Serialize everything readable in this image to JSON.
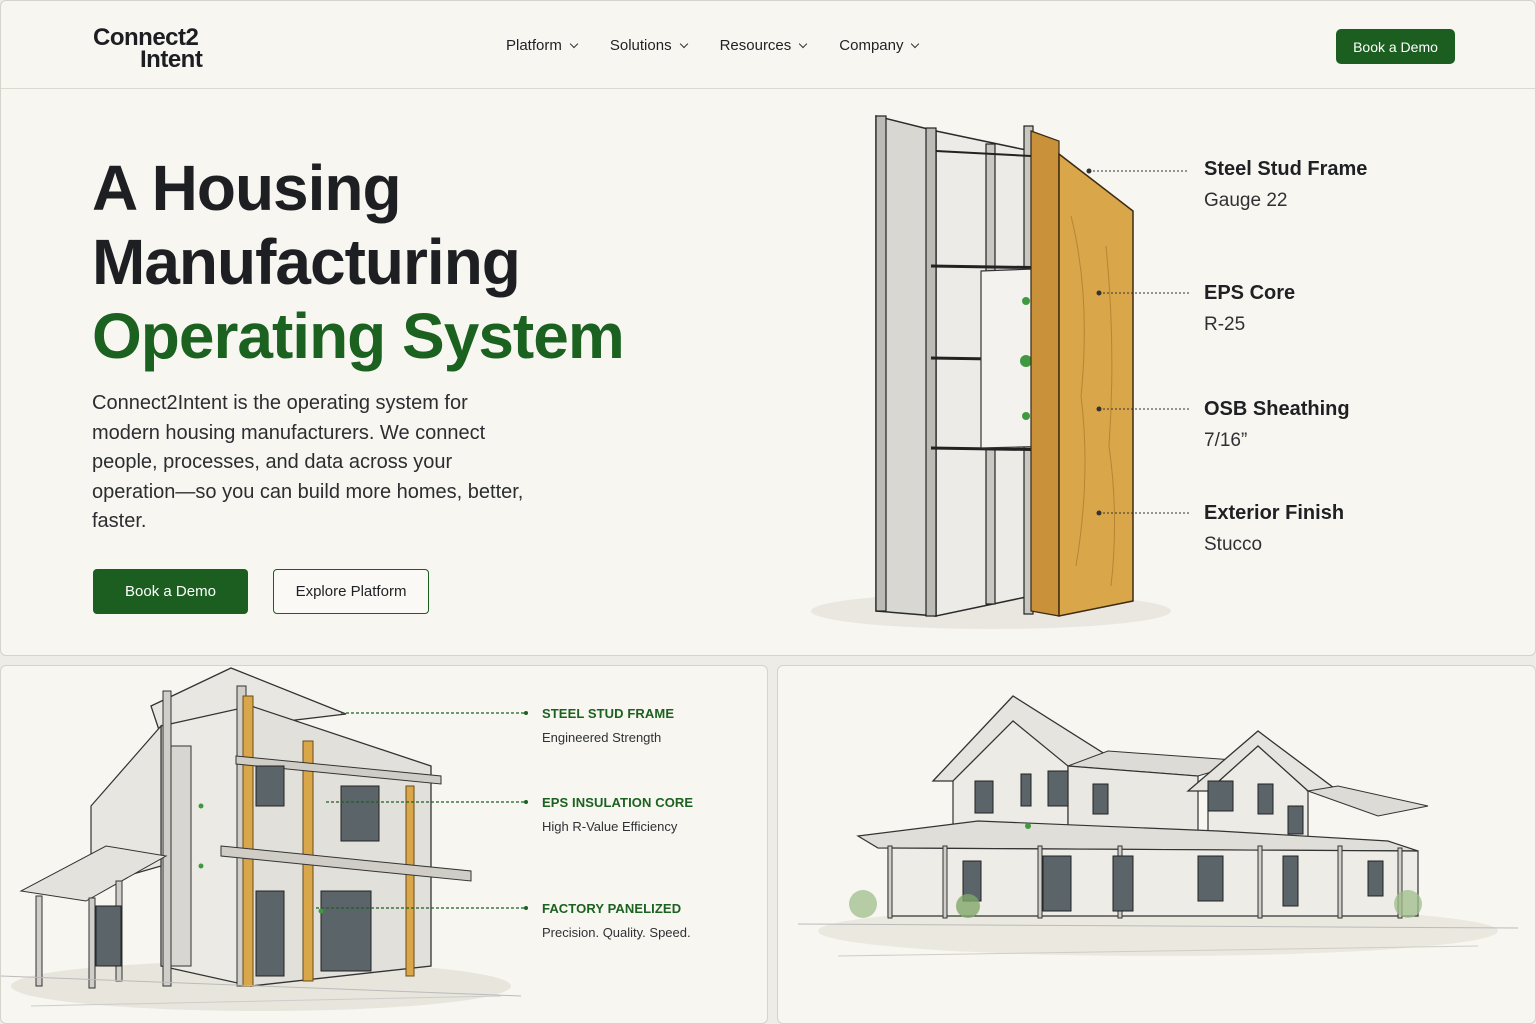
{
  "brand": {
    "logo_line1": "Connect2",
    "logo_line2": "Intent"
  },
  "nav": {
    "items": [
      {
        "label": "Platform"
      },
      {
        "label": "Solutions"
      },
      {
        "label": "Resources"
      },
      {
        "label": "Company"
      }
    ],
    "cta_label": "Book a Demo"
  },
  "hero": {
    "headline_line1": "A Housing",
    "headline_line2": "Manufacturing",
    "headline_line3": "Operating System",
    "description": "Connect2Intent is the operating system for modern housing manufacturers. We connect people, processes, and data across your operation—so you can build more homes, better, faster.",
    "primary_cta": "Book a Demo",
    "secondary_cta": "Explore Platform"
  },
  "wall_specs": [
    {
      "name": "Steel Stud Frame",
      "value": "Gauge 22"
    },
    {
      "name": "EPS Core",
      "value": "R-25"
    },
    {
      "name": "OSB Sheathing",
      "value": "7/16”"
    },
    {
      "name": "Exterior Finish",
      "value": "Stucco"
    }
  ],
  "features": [
    {
      "title": "STEEL STUD FRAME",
      "subtitle": "Engineered Strength"
    },
    {
      "title": "EPS INSULATION CORE",
      "subtitle": "High R-Value Efficiency"
    },
    {
      "title": "FACTORY PANELIZED",
      "subtitle": "Precision. Quality. Speed."
    }
  ],
  "colors": {
    "brand_green": "#1b5e20",
    "headline_green": "#1b6120",
    "osb": "#d9a64a",
    "background": "#f8f6f1"
  }
}
